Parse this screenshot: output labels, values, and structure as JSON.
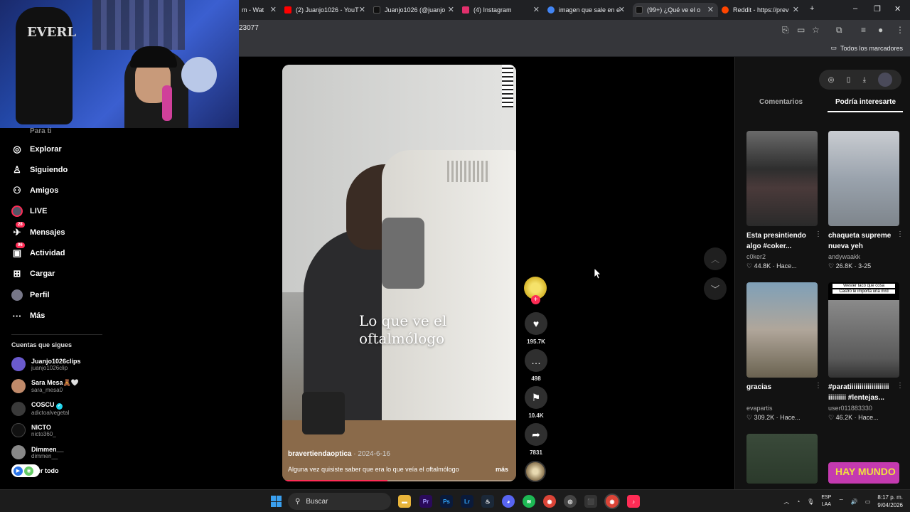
{
  "browser": {
    "tabs": [
      {
        "label": "m - Wat",
        "color": "#5f6368"
      },
      {
        "label": "(2) Juanjo1026 - YouT",
        "color": "#ff0000"
      },
      {
        "label": "Juanjo1026 (@juanjo",
        "color": "#000000"
      },
      {
        "label": "(4) Instagram",
        "color": "#e1306c"
      },
      {
        "label": "imagen que sale en e",
        "color": "#4285f4"
      },
      {
        "label": "(99+) ¿Qué ve el o",
        "color": "#000000"
      },
      {
        "label": "Reddit - https://prev",
        "color": "#ff4500"
      }
    ],
    "address": "23077",
    "bookmarks_all": "Todos los marcadores"
  },
  "nav": {
    "top_cut": "Para ti",
    "items": [
      {
        "label": "Explorar",
        "icon": "compass-icon"
      },
      {
        "label": "Siguiendo",
        "icon": "following-icon"
      },
      {
        "label": "Amigos",
        "icon": "friends-icon"
      },
      {
        "label": "LIVE",
        "icon": "live-icon"
      },
      {
        "label": "Mensajes",
        "icon": "messages-icon",
        "badge": "28"
      },
      {
        "label": "Actividad",
        "icon": "activity-icon",
        "badge": "96"
      },
      {
        "label": "Cargar",
        "icon": "upload-icon"
      },
      {
        "label": "Perfil",
        "icon": "profile-icon"
      },
      {
        "label": "Más",
        "icon": "more-icon"
      }
    ],
    "following_title": "Cuentas que sigues",
    "accounts": [
      {
        "name": "Juanjo1026clips",
        "user": "juanjo1026clip",
        "color": "#6a5acd"
      },
      {
        "name": "Sara Mesa🧸🤍",
        "user": "sara_mesa0",
        "color": "#c08a6a"
      },
      {
        "name": "COSCU",
        "user": "adictoalvegetal",
        "color": "#3a3a3a",
        "verified": "✓"
      },
      {
        "name": "NICTO",
        "user": "nicto360_",
        "color": "#111111"
      },
      {
        "name": "Dimmen__",
        "user": "dimmen__",
        "color": "#888888"
      }
    ],
    "see_all": "er todo"
  },
  "video": {
    "caption_overlay": "Lo que ve el oftalmólogo",
    "author": "bravertiendaoptica",
    "date": "· 2024-6-16",
    "description": "Alguna vez quisiste saber que era lo que veía el oftalmólogo",
    "more": "más",
    "progress_fraction": 0.45
  },
  "actions": {
    "likes": "195.7K",
    "comments": "498",
    "saves": "10.4K",
    "shares": "7831"
  },
  "right_panel": {
    "tab_comments": "Comentarios",
    "tab_suggest": "Podría interesarte",
    "cards": [
      {
        "title": "Esta presintiendo algo #coker...",
        "author": "c0ker2",
        "likes": "44.8K",
        "time": "Hace...",
        "thumb": "#3a3a3a"
      },
      {
        "title": "chaqueta supreme nueva yeh",
        "author": "andywaakk",
        "likes": "26.8K",
        "time": "3-25",
        "thumb": "#9aa3ad"
      },
      {
        "title": "gracias",
        "author": "evapartis",
        "likes": "309.2K",
        "time": "Hace...",
        "thumb": "#b0a69a"
      },
      {
        "title": "#paratiiiiiiiiiiiiiiiiiiii iiiiiiiii #lentejas...",
        "author": "user011883330",
        "likes": "46.2K",
        "time": "Hace...",
        "thumb": "#5a5a5a",
        "overlay1": "Wester tacó que cosa",
        "overlay2": "Castro le importa una mrd"
      },
      {
        "title": "",
        "author": "",
        "likes": "",
        "time": "",
        "thumb": "#2b3a2b"
      },
      {
        "title": "",
        "author": "",
        "likes": "",
        "time": "",
        "thumb": "#c43ab0",
        "overlay1": "HAY MUNDO"
      }
    ]
  },
  "taskbar": {
    "search": "Buscar",
    "lang1": "ESP",
    "lang2": "LAA",
    "time": "8:17 p. m.",
    "date": "9/04/2026"
  }
}
